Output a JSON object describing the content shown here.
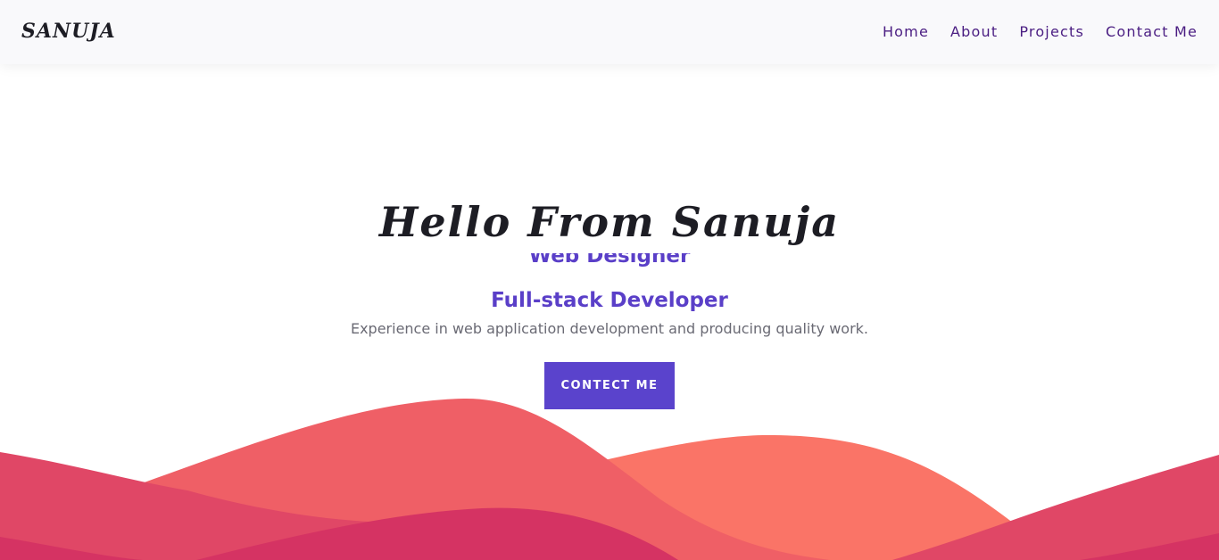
{
  "nav": {
    "logo": "SANUJA",
    "links": [
      "Home",
      "About",
      "Projects",
      "Contact Me"
    ]
  },
  "hero": {
    "title": "Hello From Sanuja",
    "role_previous": "Web Designer",
    "role_current": "Full-stack Developer",
    "description": "Experience in web application development and producing quality work.",
    "cta_label": "CONTECT ME"
  },
  "colors": {
    "accent": "#5a43cc",
    "nav_link": "#4a1d82",
    "wave_coral": "#ef5f66",
    "wave_orange": "#fa7467",
    "wave_pink": "#e04766",
    "wave_magenta": "#d53363"
  }
}
